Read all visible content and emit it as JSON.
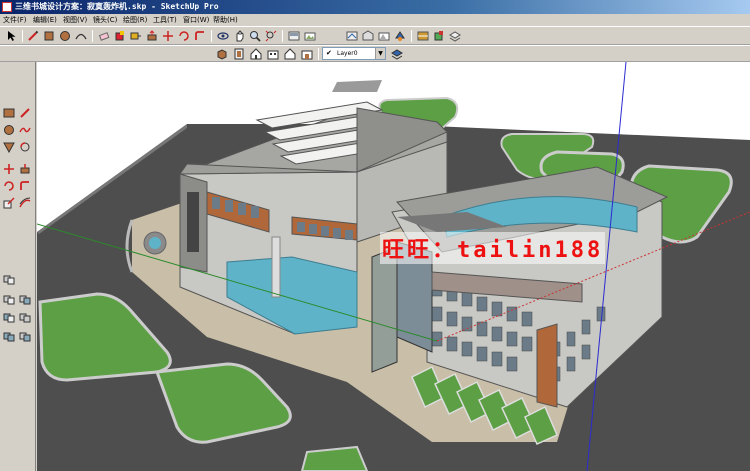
{
  "window": {
    "title": "三维书城设计方案：寂寞轰炸机.skp - SketchUp Pro"
  },
  "menu": [
    "文件(F)",
    "编辑(E)",
    "视图(V)",
    "镜头(C)",
    "绘图(R)",
    "工具(T)",
    "窗口(W)",
    "帮助(H)"
  ],
  "layers": {
    "current": "Layer0",
    "visible_check": "✔"
  },
  "watermark": {
    "text": "旺旺：tailin188"
  },
  "toolbar_row1": [
    "select-icon",
    "pencil-icon",
    "rectangle-icon",
    "circle-icon",
    "arc-icon",
    "eraser-icon",
    "paint-bucket-icon",
    "tape-measure-icon",
    "push-pull-icon",
    "move-icon",
    "rotate-icon",
    "follow-me-icon",
    "orbit-icon",
    "pan-icon",
    "zoom-icon",
    "zoom-extents-icon",
    "component-icon",
    "scenes-icon",
    "warehouse-icon",
    "materials-icon",
    "styles-icon",
    "paint-icon",
    "layers-manager-icon"
  ],
  "toolbar_row2": [
    "iso-view-icon",
    "top-view-icon",
    "front-view-icon",
    "right-view-icon",
    "back-view-icon",
    "left-view-icon",
    "layer-visibility-icon",
    "layer-manager-icon"
  ],
  "left_palette": [
    "rectangle-tool-icon",
    "line-tool-icon",
    "circle-tool-icon",
    "freehand-tool-icon",
    "polygon-tool-icon",
    "arc-tool-icon",
    "move-tool-icon",
    "pushpull-tool-icon",
    "rotate-tool-icon",
    "followme-tool-icon",
    "scale-tool-icon",
    "offset-tool-icon",
    "section-tool-icon",
    "outliner-icon",
    "component-tool-icon",
    "group-tool-icon",
    "camera-tool-icon",
    "walk-tool-icon"
  ],
  "colors": {
    "ground": "#5a5a5a",
    "plaza": "#c9bfa8",
    "grass": "#5c9f45",
    "water": "#5fb3c8",
    "roof": "#a6a6a2",
    "brick": "#b0683a",
    "wall": "#c8c8c4"
  }
}
